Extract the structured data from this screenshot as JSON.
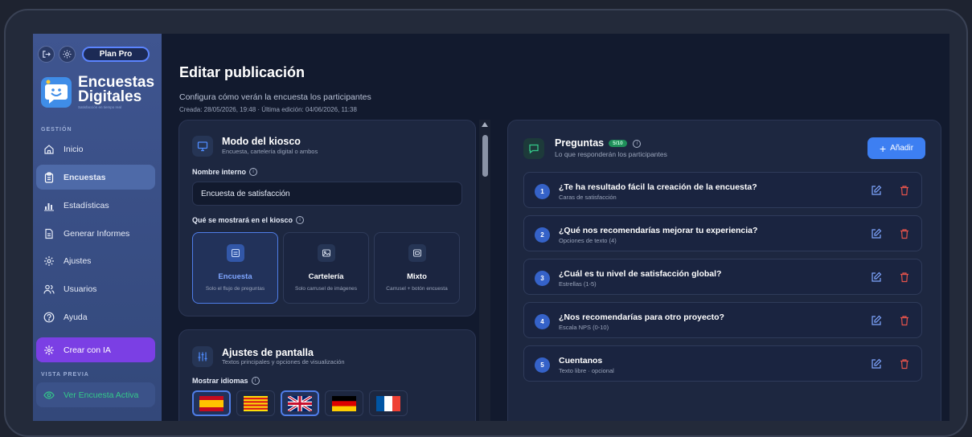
{
  "sidebar": {
    "plan_label": "Plan Pro",
    "brand_line1": "Encuestas",
    "brand_line2": "Digitales",
    "brand_tagline": "Satisfacción en tiempo real",
    "section_gestion": "GESTIÓN",
    "items": [
      {
        "label": "Inicio",
        "icon": "home-icon"
      },
      {
        "label": "Encuestas",
        "icon": "clipboard-icon",
        "active": true
      },
      {
        "label": "Estadísticas",
        "icon": "bar-chart-icon"
      },
      {
        "label": "Generar Informes",
        "icon": "document-icon"
      },
      {
        "label": "Ajustes",
        "icon": "gear-icon"
      },
      {
        "label": "Usuarios",
        "icon": "users-icon"
      },
      {
        "label": "Ayuda",
        "icon": "help-icon"
      }
    ],
    "ia_label": "Crear con IA",
    "section_preview": "VISTA PREVIA",
    "preview_label": "Ver Encuesta Activa"
  },
  "header": {
    "title": "Editar publicación",
    "subtitle": "Configura cómo verán la encuesta los participantes",
    "meta": "Creada: 28/05/2026, 19:48 · Última edición: 04/06/2026, 11:38"
  },
  "kiosk": {
    "title": "Modo del kiosco",
    "subtitle": "Encuesta, cartelería digital o ambos",
    "internal_name_label": "Nombre interno",
    "internal_name_value": "Encuesta de satisfacción",
    "display_label": "Qué se mostrará en el kiosco",
    "options": [
      {
        "title": "Encuesta",
        "desc": "Solo el flujo de preguntas",
        "icon": "form-icon"
      },
      {
        "title": "Cartelería",
        "desc": "Solo carrusel de imágenes",
        "icon": "image-icon"
      },
      {
        "title": "Mixto",
        "desc": "Carrusel + botón encuesta",
        "icon": "mixed-icon"
      }
    ]
  },
  "screen": {
    "title": "Ajustes de pantalla",
    "subtitle": "Textos principales y opciones de visualización",
    "languages_label": "Mostrar idiomas",
    "flags": [
      "es",
      "ca",
      "gb",
      "de",
      "fr"
    ]
  },
  "questions": {
    "title": "Preguntas",
    "count": "5/10",
    "subtitle": "Lo que responderán los participantes",
    "add_label": "Añadir",
    "items": [
      {
        "num": "1",
        "title": "¿Te ha resultado fácil la creación de la encuesta?",
        "type": "Caras de satisfacción"
      },
      {
        "num": "2",
        "title": "¿Qué nos recomendarías mejorar tu experiencia?",
        "type": "Opciones de texto (4)"
      },
      {
        "num": "3",
        "title": "¿Cuál es tu nivel de satisfacción global?",
        "type": "Estrellas (1-5)"
      },
      {
        "num": "4",
        "title": "¿Nos recomendarías para otro proyecto?",
        "type": "Escala NPS (0-10)"
      },
      {
        "num": "5",
        "title": "Cuentanos",
        "type": "Texto libre · opcional"
      }
    ]
  },
  "colors": {
    "accent": "#3d7ff2",
    "sidebar": "#3f5590",
    "ia": "#7b3fe4",
    "preview_text": "#34c98a",
    "delete": "#e5534b"
  }
}
